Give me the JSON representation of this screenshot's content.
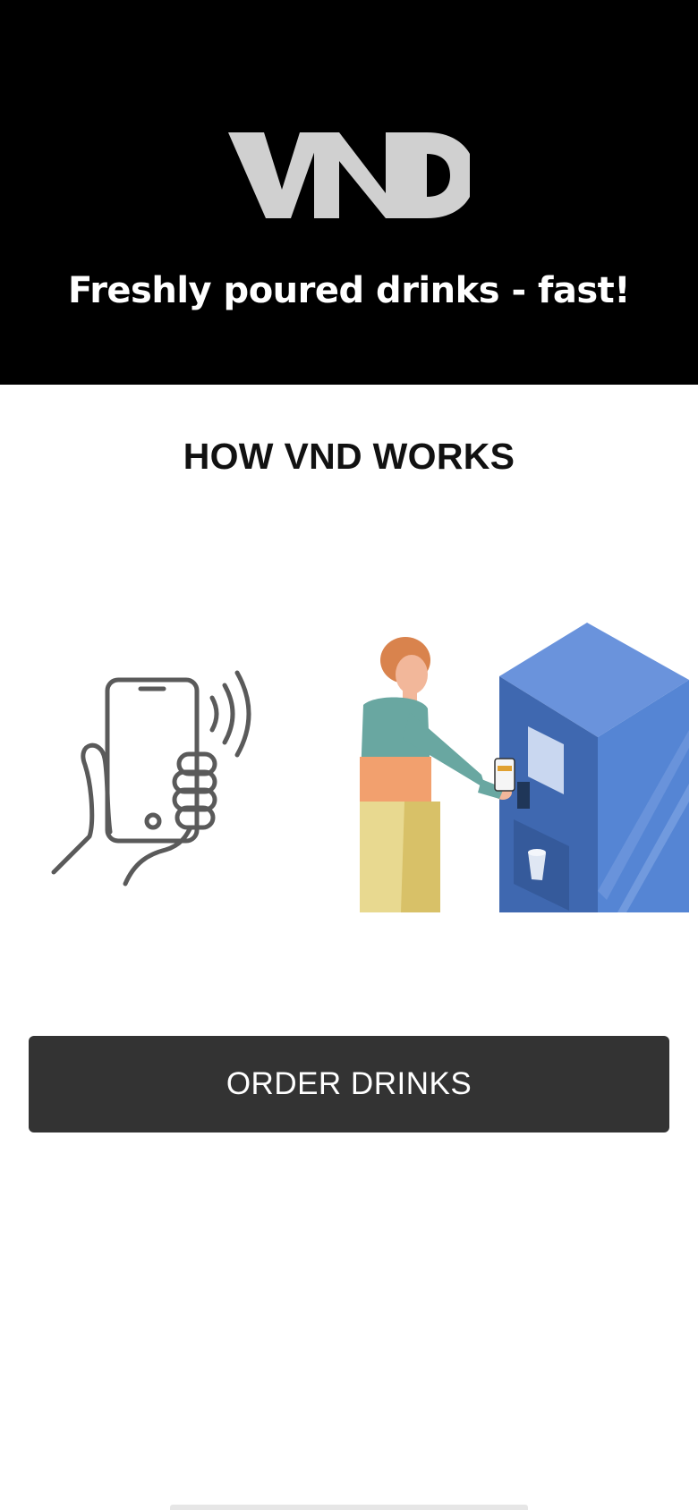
{
  "header": {
    "logo_text": "VND",
    "tagline": "Freshly poured drinks - fast!"
  },
  "how_it_works": {
    "title": "HOW VND WORKS"
  },
  "illustrations": {
    "phone": "contactless-phone-icon",
    "vending": "person-using-vending-machine"
  },
  "actions": {
    "order_label": "ORDER DRINKS"
  },
  "colors": {
    "hero_background": "#000000",
    "logo": "#d0d0d0",
    "button_background": "#333333",
    "machine_blue": "#4f7fcf",
    "icon_gray": "#5a5a5a"
  }
}
